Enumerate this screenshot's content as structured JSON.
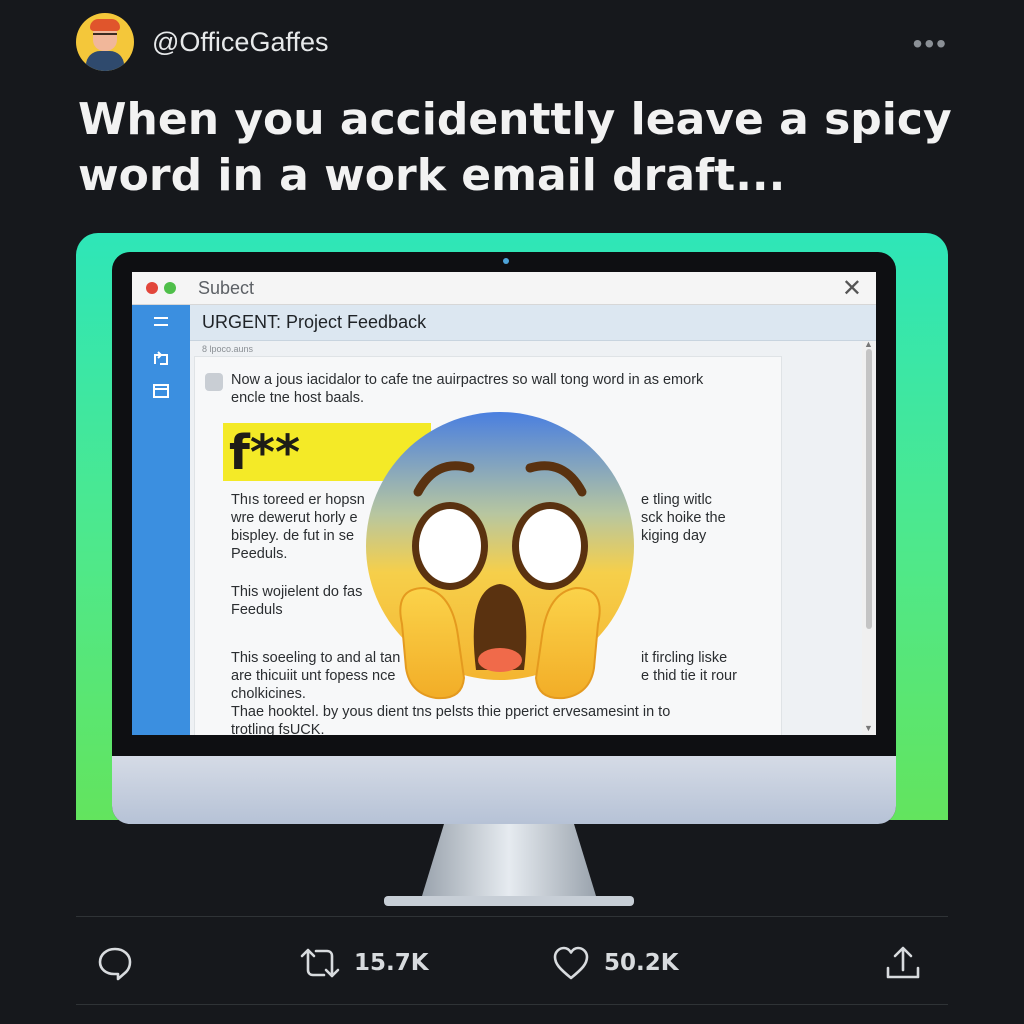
{
  "post": {
    "handle": "@OfficeGaffes",
    "more_label": "•••",
    "title_line1": "When you accidenttly leave a spicy",
    "title_line2": "word in a work email draft..."
  },
  "email_window": {
    "window_title": "Subect",
    "close_label": "✕",
    "subject": "URGENT: Project Feedback",
    "meta": "8 lpoco.auns",
    "intro_line1": "Now a jous iacidalor to cafe tne auirpactres so wall tong word in as emork",
    "intro_line2": "encle tne host baals.",
    "censored_word": "f**",
    "para1": [
      "Thıs toreed er hopsn",
      "wre dewerut horly e",
      "bispley. de fut in se",
      "Peeduls."
    ],
    "para1_right": [
      "e tling witlc",
      "sck hoike the",
      "kiging day"
    ],
    "para2": [
      "This wojielent do fas",
      "Feeduls"
    ],
    "para3": [
      "This soeeling to and al tan",
      "are thicuiit unt fopess nce",
      "cholkicines."
    ],
    "para3_right": [
      "it fircling liske",
      "e thid tie it rour"
    ],
    "para4": [
      "Thae hooktel. by yous dient tns pelsts thie pperict ervesamesint in to",
      "trotling fsUCK."
    ]
  },
  "actions": {
    "reply_count": "",
    "retweet_count": "15.7K",
    "like_count": "50.2K"
  },
  "icons": [
    "avatar",
    "more-icon",
    "menu-icon",
    "compose-icon",
    "inbox-icon",
    "reply-icon",
    "retweet-icon",
    "like-icon",
    "share-icon",
    "screaming-emoji"
  ],
  "colors": {
    "background": "#16181c",
    "gradient_top": "#2ee6b8",
    "gradient_bottom": "#63e45e",
    "sidebar": "#3b8fe0",
    "highlight": "#f4ea27"
  }
}
